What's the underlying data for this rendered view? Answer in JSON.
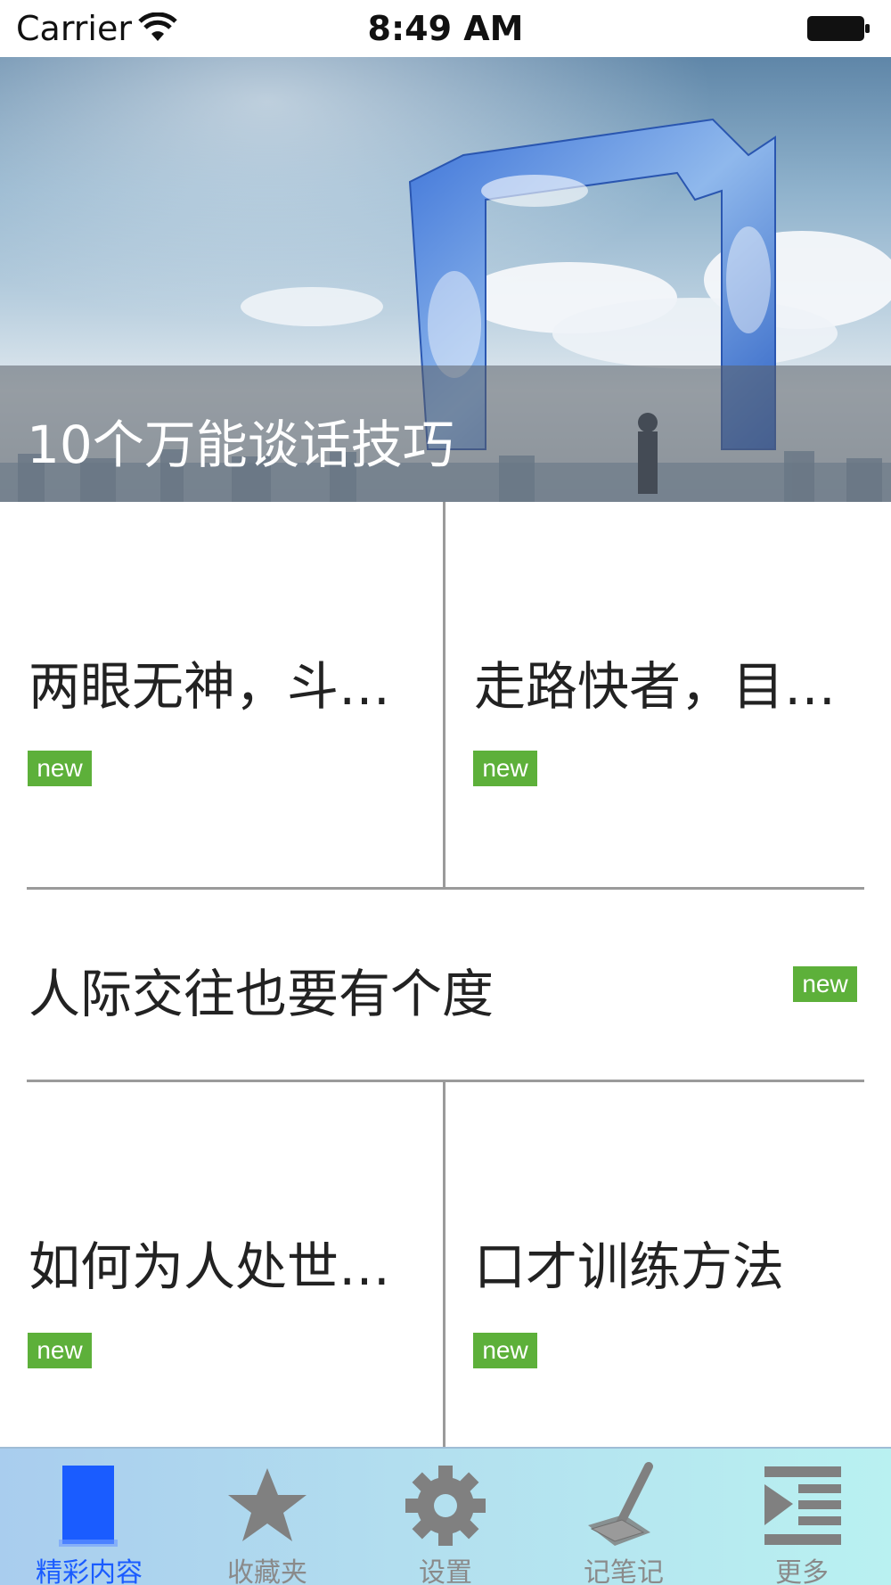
{
  "status_bar": {
    "carrier": "Carrier",
    "time": "8:49 AM"
  },
  "hero": {
    "title": "10个万能谈话技巧"
  },
  "cards": [
    {
      "title": "两眼无神，斗…",
      "badge": "new"
    },
    {
      "title": "走路快者，目…",
      "badge": "new"
    },
    {
      "title": "人际交往也要有个度",
      "badge": "new"
    },
    {
      "title": "如何为人处世…",
      "badge": "new"
    },
    {
      "title": "口才训练方法",
      "badge": "new"
    }
  ],
  "tab_bar": {
    "tabs": [
      {
        "label": "精彩内容",
        "icon": "book-icon",
        "active": true
      },
      {
        "label": "收藏夹",
        "icon": "star-icon",
        "active": false
      },
      {
        "label": "设置",
        "icon": "gear-icon",
        "active": false
      },
      {
        "label": "记笔记",
        "icon": "pen-icon",
        "active": false
      },
      {
        "label": "更多",
        "icon": "more-list-icon",
        "active": false
      }
    ]
  },
  "colors": {
    "badge": "#5db03a",
    "active_tab": "#1a5cff",
    "inactive_tab": "#8a8a8a"
  }
}
